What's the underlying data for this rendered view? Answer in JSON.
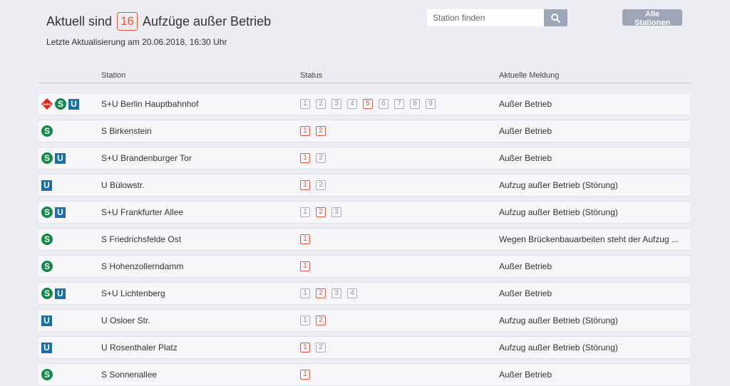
{
  "header": {
    "title_prefix": "Aktuell sind",
    "count": "16",
    "title_suffix": "Aufzüge außer Betrieb",
    "updated": "Letzte Aktualisierung am 20.06.2018, 16:30 Uhr"
  },
  "search": {
    "placeholder": "Station finden"
  },
  "all_stations_label": "Alle Stationen",
  "columns": {
    "station": "Station",
    "status": "Status",
    "message": "Aktuelle Meldung"
  },
  "colors": {
    "s_bahn": "#138a4a",
    "u_bahn": "#1a6fa8",
    "fault": "#e8553c",
    "ok": "#a9afbb"
  },
  "icon_text": {
    "s": "S",
    "u": "U",
    "db": "Bahn"
  },
  "rows": [
    {
      "lines": [
        "db",
        "s",
        "u"
      ],
      "station": "S+U Berlin Hauptbahnhof",
      "lifts": [
        {
          "n": "1",
          "bad": false
        },
        {
          "n": "2",
          "bad": false
        },
        {
          "n": "3",
          "bad": false
        },
        {
          "n": "4",
          "bad": false
        },
        {
          "n": "5",
          "bad": true
        },
        {
          "n": "6",
          "bad": false
        },
        {
          "n": "7",
          "bad": false
        },
        {
          "n": "8",
          "bad": false
        },
        {
          "n": "9",
          "bad": false
        }
      ],
      "message": "Außer Betrieb"
    },
    {
      "lines": [
        "s"
      ],
      "station": "S Birkenstein",
      "lifts": [
        {
          "n": "1",
          "bad": true
        },
        {
          "n": "2",
          "bad": true
        }
      ],
      "message": "Außer Betrieb"
    },
    {
      "lines": [
        "s",
        "u"
      ],
      "station": "S+U Brandenburger Tor",
      "lifts": [
        {
          "n": "1",
          "bad": true
        },
        {
          "n": "2",
          "bad": false
        }
      ],
      "message": "Außer Betrieb"
    },
    {
      "lines": [
        "u"
      ],
      "station": "U Bülowstr.",
      "lifts": [
        {
          "n": "1",
          "bad": true
        },
        {
          "n": "2",
          "bad": false
        }
      ],
      "message": "Aufzug außer Betrieb (Störung)"
    },
    {
      "lines": [
        "s",
        "u"
      ],
      "station": "S+U Frankfurter Allee",
      "lifts": [
        {
          "n": "1",
          "bad": false
        },
        {
          "n": "2",
          "bad": true
        },
        {
          "n": "3",
          "bad": false
        }
      ],
      "message": "Aufzug außer Betrieb (Störung)"
    },
    {
      "lines": [
        "s"
      ],
      "station": "S Friedrichsfelde Ost",
      "lifts": [
        {
          "n": "1",
          "bad": true
        }
      ],
      "message": "Wegen Brückenbauarbeiten steht der Aufzug ..."
    },
    {
      "lines": [
        "s"
      ],
      "station": "S Hohenzollerndamm",
      "lifts": [
        {
          "n": "1",
          "bad": true
        }
      ],
      "message": "Außer Betrieb"
    },
    {
      "lines": [
        "s",
        "u"
      ],
      "station": "S+U Lichtenberg",
      "lifts": [
        {
          "n": "1",
          "bad": false
        },
        {
          "n": "2",
          "bad": true
        },
        {
          "n": "3",
          "bad": false
        },
        {
          "n": "4",
          "bad": false
        }
      ],
      "message": "Außer Betrieb"
    },
    {
      "lines": [
        "u"
      ],
      "station": "U Osloer Str.",
      "lifts": [
        {
          "n": "1",
          "bad": false
        },
        {
          "n": "2",
          "bad": true
        }
      ],
      "message": "Aufzug außer Betrieb (Störung)"
    },
    {
      "lines": [
        "u"
      ],
      "station": "U Rosenthaler Platz",
      "lifts": [
        {
          "n": "1",
          "bad": true
        },
        {
          "n": "2",
          "bad": false
        }
      ],
      "message": "Aufzug außer Betrieb (Störung)"
    },
    {
      "lines": [
        "s"
      ],
      "station": "S Sonnenallee",
      "lifts": [
        {
          "n": "1",
          "bad": true
        }
      ],
      "message": "Außer Betrieb"
    }
  ]
}
